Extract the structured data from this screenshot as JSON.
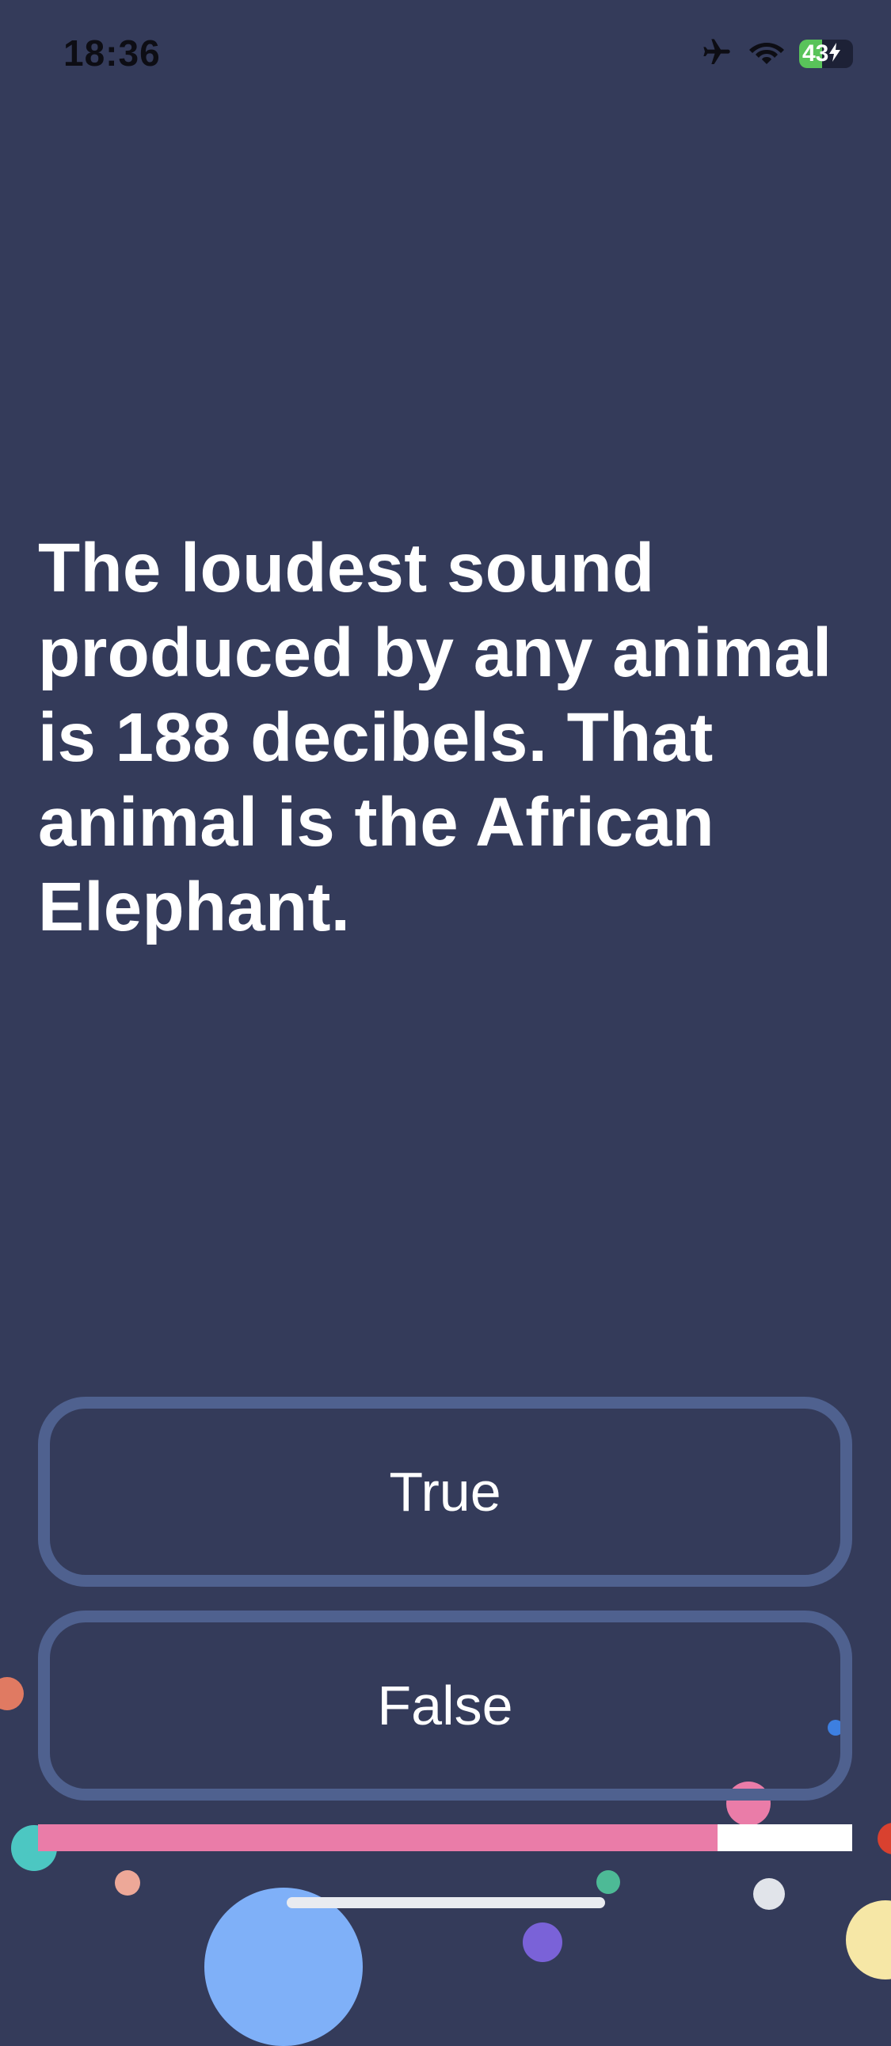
{
  "status_bar": {
    "time": "18:36",
    "battery_level": "43",
    "battery_fraction": 0.43,
    "icons": [
      "airplane-icon",
      "wifi-icon",
      "battery-icon",
      "charging-bolt-icon"
    ]
  },
  "question": {
    "text": "The loudest sound produced by any animal is 188 decibels. That animal is the African Elephant."
  },
  "answers": {
    "true_label": "True",
    "false_label": "False"
  },
  "progress": {
    "fraction": 0.835
  },
  "colors": {
    "background": "#343b5a",
    "button_border": "#4f618f",
    "progress_fill": "#ea7ca8",
    "progress_track": "#ffffff",
    "battery_fill": "#59c35a"
  }
}
